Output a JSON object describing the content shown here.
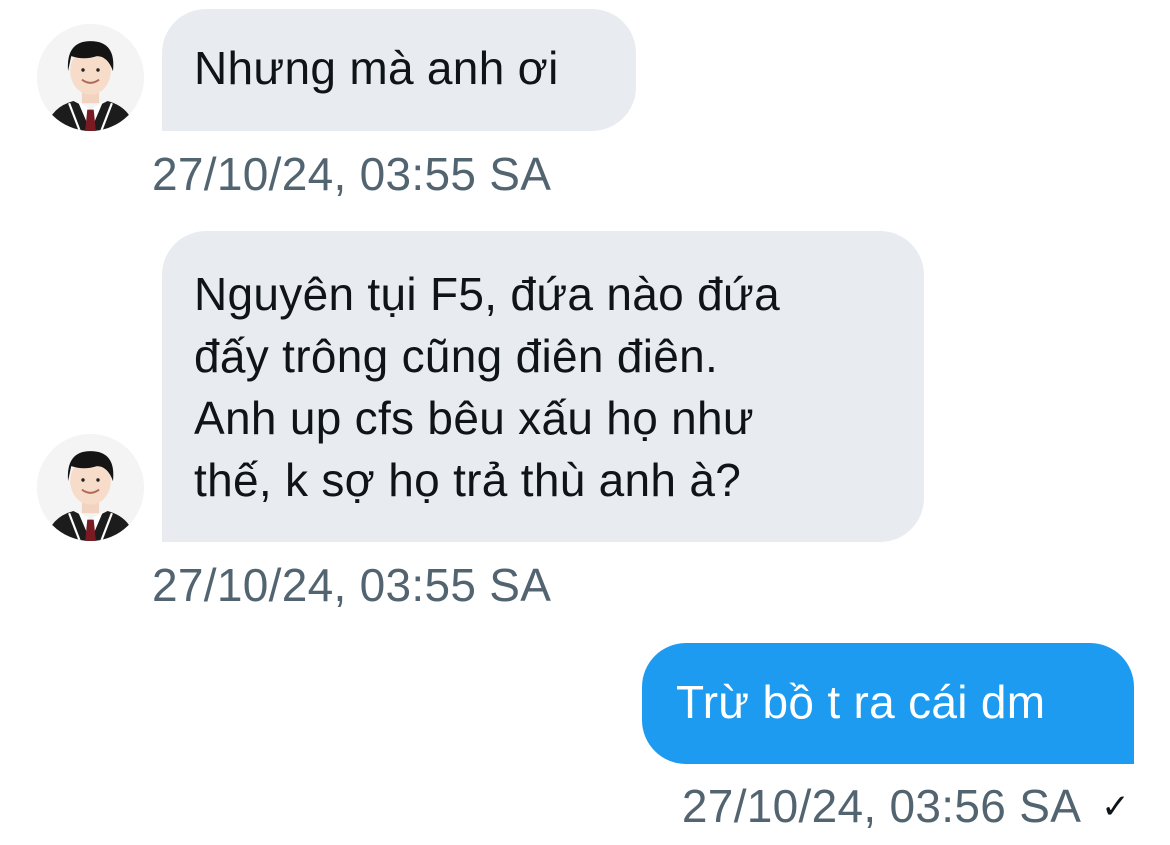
{
  "conversation": {
    "messages": [
      {
        "direction": "received",
        "text": "Nhưng mà anh ơi",
        "timestamp": "27/10/24, 03:55 SA"
      },
      {
        "direction": "received",
        "text": "Nguyên tụi F5, đứa nào đứa\nđấy trông cũng điên điên.\nAnh up cfs bêu xấu họ như\nthế, k sợ họ trả thù anh à?",
        "timestamp": "27/10/24, 03:55 SA"
      },
      {
        "direction": "sent",
        "text": "Trừ bồ t ra cái dm",
        "timestamp": "27/10/24, 03:56 SA",
        "status_icon": "✓"
      }
    ]
  },
  "colors": {
    "received_bubble": "#e8ecf0",
    "sent_bubble": "#1d9bf0",
    "timestamp": "#536471",
    "text": "#0f1419"
  },
  "icons": {
    "avatar": "user-avatar-portrait",
    "read_status": "checkmark-icon"
  }
}
